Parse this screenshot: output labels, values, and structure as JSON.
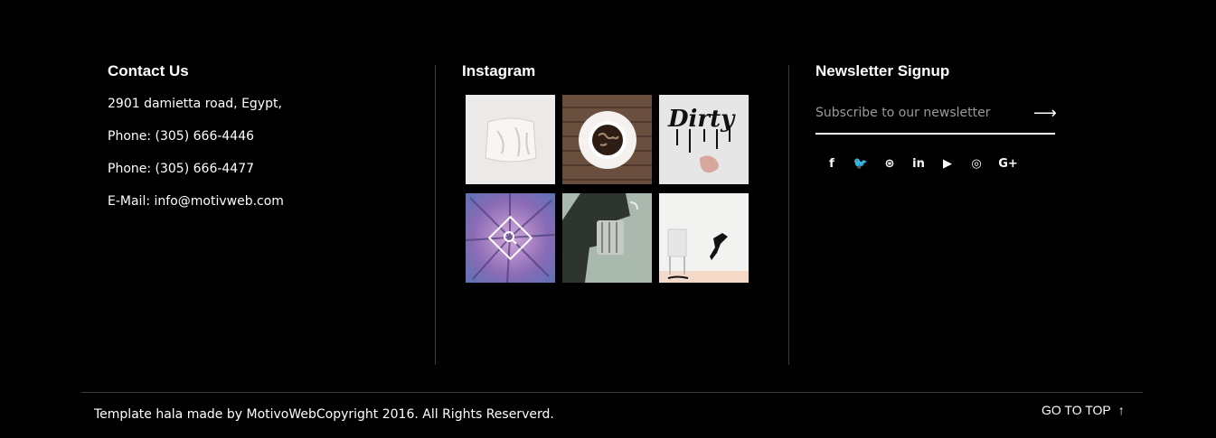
{
  "contact": {
    "heading": "Contact Us",
    "lines": [
      "2901 damietta road, Egypt,",
      "Phone: (305) 666-4446",
      "Phone: (305) 666-4477",
      "E-Mail: info@motivweb.com"
    ]
  },
  "instagram": {
    "heading": "Instagram",
    "thumbs": [
      {
        "name": "white-fabric-photo"
      },
      {
        "name": "coffee-cup-photo"
      },
      {
        "name": "dirty-lettering-photo"
      },
      {
        "name": "purple-abstract-photo",
        "overlay": "search-icon"
      },
      {
        "name": "revolver-photo"
      },
      {
        "name": "chair-figure-photo"
      }
    ]
  },
  "newsletter": {
    "heading": "Newsletter Signup",
    "placeholder": "Subscribe to our newsletter",
    "submit_icon": "arrow-right-icon",
    "socials": [
      {
        "icon": "facebook-icon",
        "glyph": "f"
      },
      {
        "icon": "twitter-icon",
        "glyph": "🐦"
      },
      {
        "icon": "dribbble-icon",
        "glyph": "⊛"
      },
      {
        "icon": "linkedin-icon",
        "glyph": "in"
      },
      {
        "icon": "youtube-icon",
        "glyph": "▶"
      },
      {
        "icon": "instagram-icon",
        "glyph": "◎"
      },
      {
        "icon": "google-plus-icon",
        "glyph": "G+"
      }
    ]
  },
  "footer": {
    "copyright": "Template hala made by MotivoWebCopyright 2016. All Rights Reserverd.",
    "go_to_top": "GO TO TOP",
    "go_to_top_icon": "arrow-up-icon"
  }
}
